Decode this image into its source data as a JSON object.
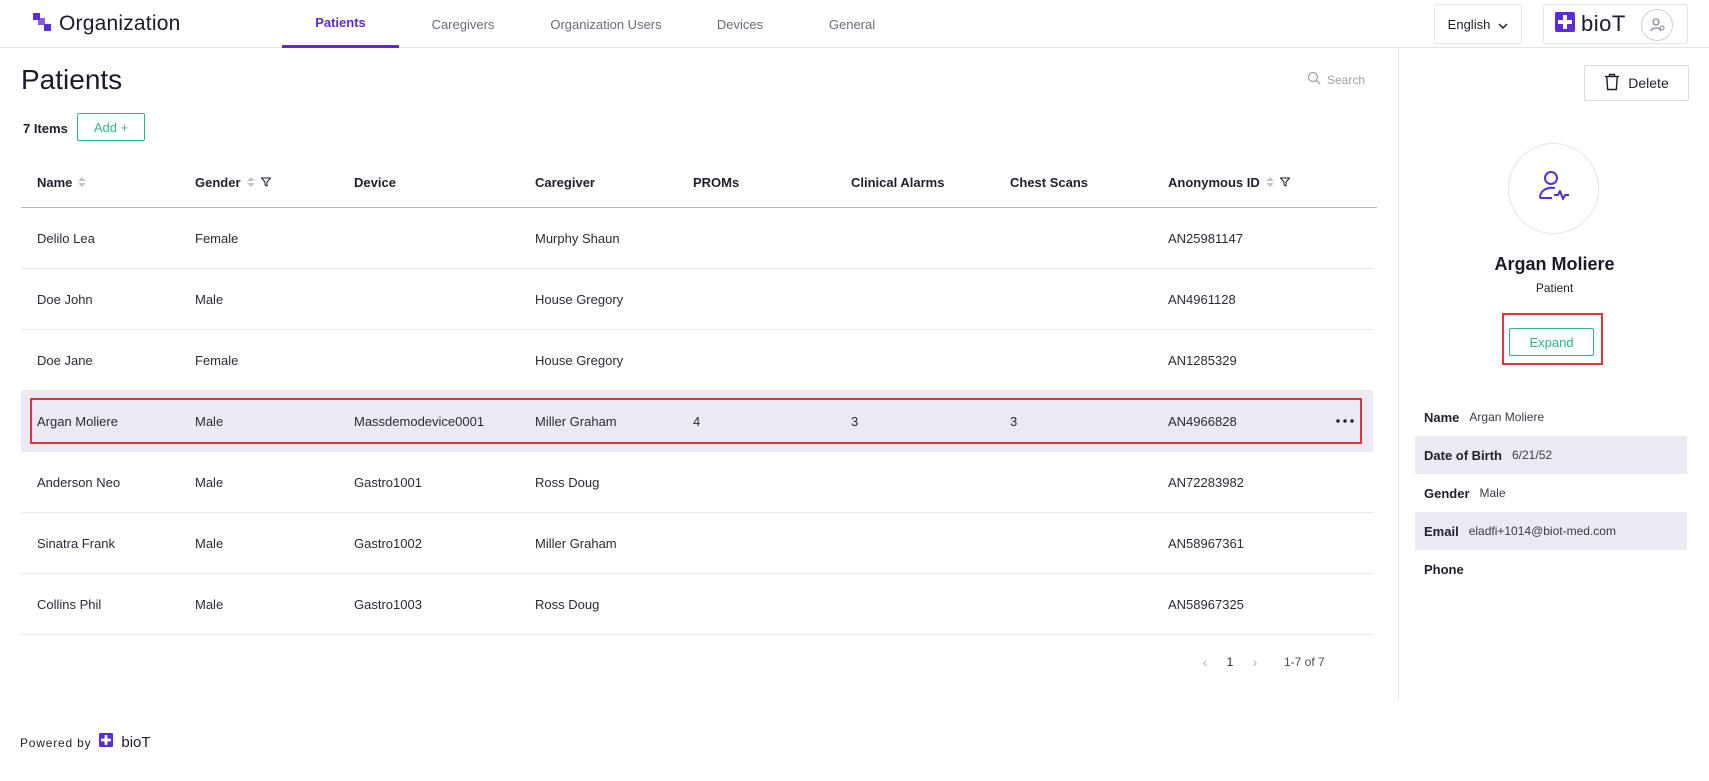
{
  "app": {
    "title": "Organization"
  },
  "nav": {
    "tabs": [
      {
        "label": "Patients",
        "active": true
      },
      {
        "label": "Caregivers",
        "active": false
      },
      {
        "label": "Organization Users",
        "active": false
      },
      {
        "label": "Devices",
        "active": false
      },
      {
        "label": "General",
        "active": false
      }
    ]
  },
  "header": {
    "language": "English",
    "logo_text": "bioT"
  },
  "main": {
    "title": "Patients",
    "search_placeholder": "Search",
    "items_count": "7 Items",
    "add_label": "Add +",
    "columns": [
      "Name",
      "Gender",
      "Device",
      "Caregiver",
      "PROMs",
      "Clinical Alarms",
      "Chest Scans",
      "Anonymous ID"
    ],
    "rows": [
      {
        "name": "Delilo Lea",
        "gender": "Female",
        "device": "",
        "caregiver": "Murphy Shaun",
        "proms": "",
        "alarms": "",
        "scans": "",
        "anon_id": "AN25981147"
      },
      {
        "name": "Doe John",
        "gender": "Male",
        "device": "",
        "caregiver": "House Gregory",
        "proms": "",
        "alarms": "",
        "scans": "",
        "anon_id": "AN4961128"
      },
      {
        "name": "Doe Jane",
        "gender": "Female",
        "device": "",
        "caregiver": "House Gregory",
        "proms": "",
        "alarms": "",
        "scans": "",
        "anon_id": "AN1285329"
      },
      {
        "name": "Argan Moliere",
        "gender": "Male",
        "device": "Massdemodevice0001",
        "caregiver": "Miller Graham",
        "proms": "4",
        "alarms": "3",
        "scans": "3",
        "anon_id": "AN4966828"
      },
      {
        "name": "Anderson Neo",
        "gender": "Male",
        "device": "Gastro1001",
        "caregiver": "Ross Doug",
        "proms": "",
        "alarms": "",
        "scans": "",
        "anon_id": "AN72283982"
      },
      {
        "name": "Sinatra Frank",
        "gender": "Male",
        "device": "Gastro1002",
        "caregiver": "Miller Graham",
        "proms": "",
        "alarms": "",
        "scans": "",
        "anon_id": "AN58967361"
      },
      {
        "name": "Collins Phil",
        "gender": "Male",
        "device": "Gastro1003",
        "caregiver": "Ross Doug",
        "proms": "",
        "alarms": "",
        "scans": "",
        "anon_id": "AN58967325"
      }
    ],
    "selected_row": 3,
    "more_icon": "ellipsis-icon",
    "pagination": {
      "current_page": "1",
      "range": "1-7 of 7",
      "prev_icon": "chevron-left-icon",
      "next_icon": "chevron-right-icon"
    }
  },
  "footer": {
    "powered_by": "Powered by",
    "logo_text": "bioT"
  },
  "panel": {
    "delete_label": "Delete",
    "patient_name": "Argan Moliere",
    "patient_role": "Patient",
    "expand_label": "Expand",
    "details": [
      {
        "label": "Name",
        "value": "Argan Moliere"
      },
      {
        "label": "Date of Birth",
        "value": "6/21/52"
      },
      {
        "label": "Gender",
        "value": "Male"
      },
      {
        "label": "Email",
        "value": "eladfi+1014@biot-med.com"
      },
      {
        "label": "Phone",
        "value": ""
      }
    ]
  },
  "colors": {
    "accent_purple": "#5a2bd6",
    "accent_green": "#2bb886",
    "highlight_red": "#e0343f",
    "selected_row_bg": "#ece9f2"
  }
}
